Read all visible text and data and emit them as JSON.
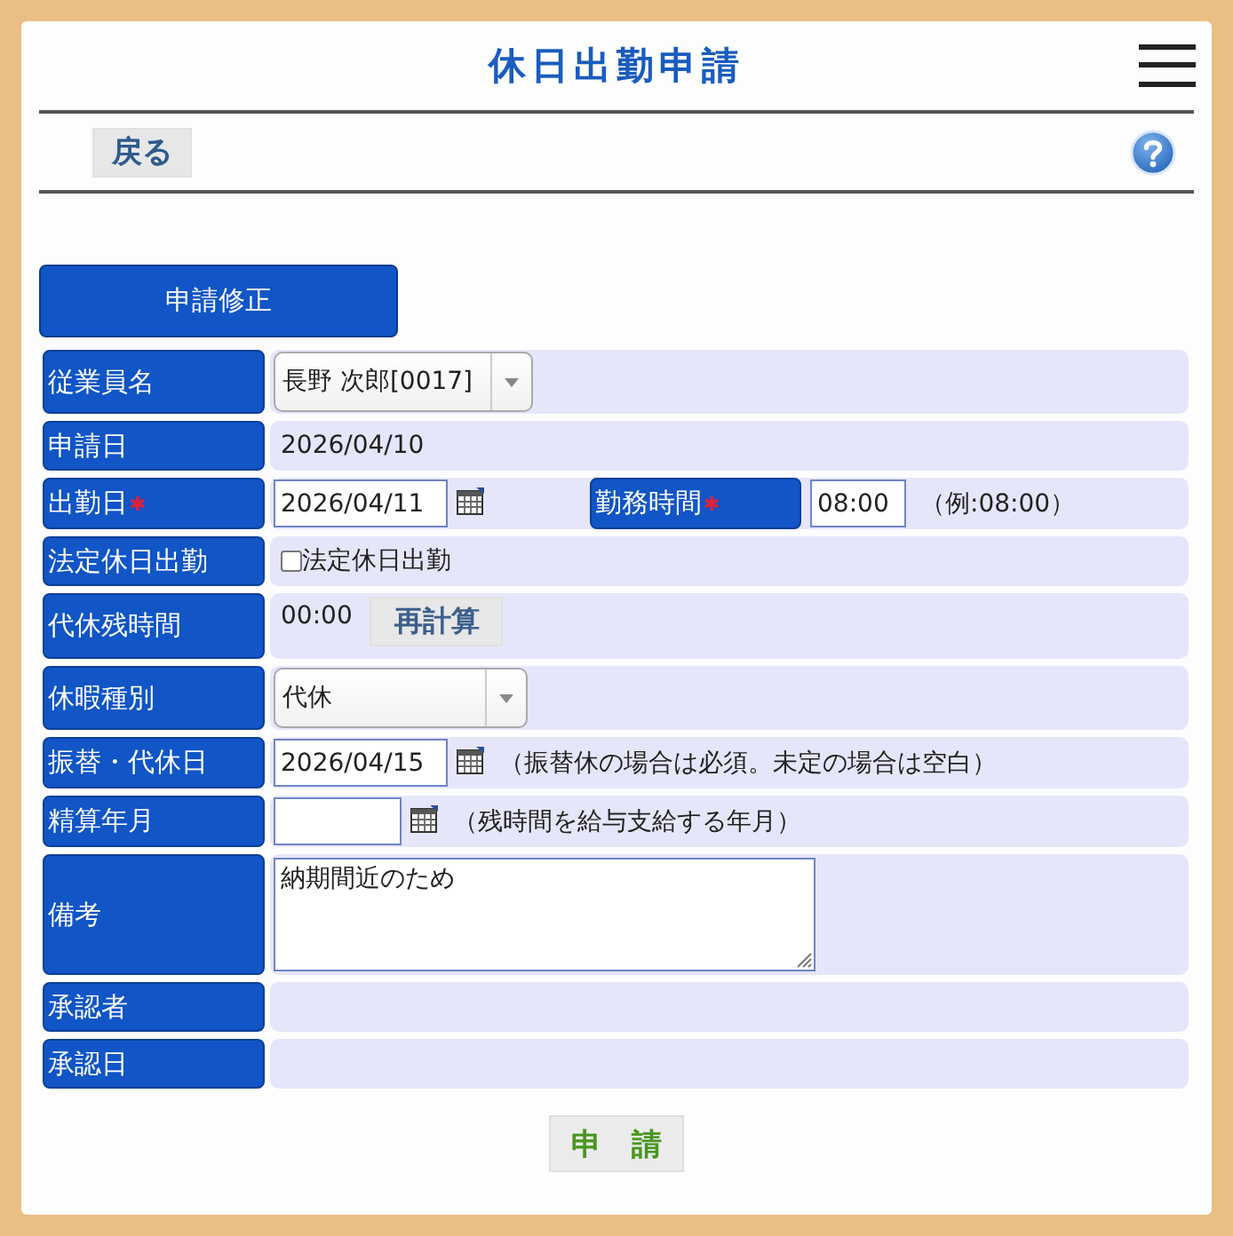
{
  "header": {
    "title": "休日出勤申請"
  },
  "toolbar": {
    "back_button": "戻る"
  },
  "mode_button": "申請修正",
  "form": {
    "rows": [
      {
        "label": "従業員名",
        "required": false,
        "items": [
          {
            "kind": "select",
            "value": "長野 次郎[0017]"
          }
        ]
      },
      {
        "label": "申請日",
        "required": false,
        "items": [
          {
            "kind": "text",
            "value": "2026/04/10"
          }
        ]
      },
      {
        "label": "出勤日",
        "required": true,
        "items": [
          {
            "kind": "date",
            "value": "2026/04/11"
          },
          {
            "kind": "label",
            "text": "勤務時間",
            "required": true
          },
          {
            "kind": "input",
            "value": "08:00"
          },
          {
            "kind": "note",
            "text": "（例:08:00）"
          }
        ]
      },
      {
        "label": "法定休日出勤",
        "required": false,
        "items": [
          {
            "kind": "checkbox",
            "checked": false,
            "text": "法定休日出勤"
          }
        ]
      },
      {
        "label": "代休残時間",
        "required": false,
        "items": [
          {
            "kind": "text",
            "value": "00:00"
          },
          {
            "kind": "button",
            "text": "再計算"
          }
        ]
      },
      {
        "label": "休暇種別",
        "required": false,
        "items": [
          {
            "kind": "select",
            "value": "代休"
          }
        ]
      },
      {
        "label": "振替・代休日",
        "required": false,
        "items": [
          {
            "kind": "date",
            "value": "2026/04/15"
          },
          {
            "kind": "note",
            "text": "（振替休の場合は必須。未定の場合は空白）"
          }
        ]
      },
      {
        "label": "精算年月",
        "required": false,
        "items": [
          {
            "kind": "month"
          },
          {
            "kind": "note",
            "text": "（残時間を給与支給する年月）"
          }
        ]
      },
      {
        "label": "備考",
        "required": false,
        "items": [
          {
            "kind": "textarea",
            "value": "納期間近のため"
          }
        ]
      },
      {
        "label": "承認者",
        "required": false
      },
      {
        "label": "承認日",
        "required": false
      }
    ]
  },
  "submit_button": "申　請"
}
